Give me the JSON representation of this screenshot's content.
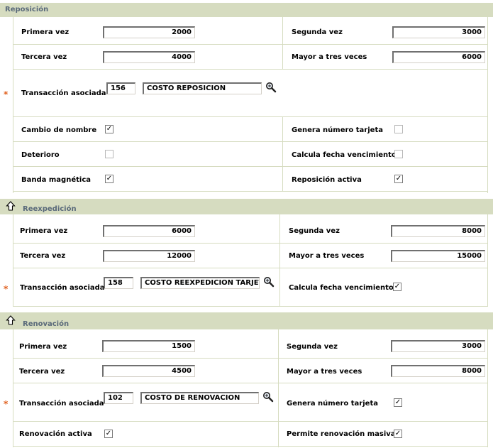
{
  "reposicion": {
    "title": "Reposición",
    "primera_label": "Primera vez",
    "primera_value": "2000",
    "segunda_label": "Segunda vez",
    "segunda_value": "3000",
    "tercera_label": "Tercera vez",
    "tercera_value": "4000",
    "mayor_label": "Mayor a tres veces",
    "mayor_value": "6000",
    "required_mark": "*",
    "transaccion_label": "Transacción asociada",
    "transaccion_code": "156",
    "transaccion_desc": "COSTO REPOSICION",
    "cambio_label": "Cambio de nombre",
    "cambio_checked": true,
    "genera_label": "Genera número tarjeta",
    "genera_checked": false,
    "deterioro_label": "Deterioro",
    "deterioro_checked": false,
    "calcula_label": "Calcula fecha vencimiento",
    "calcula_checked": false,
    "banda_label": "Banda magnética",
    "banda_checked": true,
    "activa_label": "Reposición activa",
    "activa_checked": true
  },
  "reexpedicion": {
    "title": "Reexpedición",
    "primera_label": "Primera vez",
    "primera_value": "6000",
    "segunda_label": "Segunda vez",
    "segunda_value": "8000",
    "tercera_label": "Tercera vez",
    "tercera_value": "12000",
    "mayor_label": "Mayor a tres veces",
    "mayor_value": "15000",
    "required_mark": "*",
    "transaccion_label": "Transacción asociada",
    "transaccion_code": "158",
    "transaccion_desc": "COSTO REEXPEDICION TARJETA",
    "calcula_label": "Calcula fecha vencimiento",
    "calcula_checked": true
  },
  "renovacion": {
    "title": "Renovación",
    "primera_label": "Primera vez",
    "primera_value": "1500",
    "segunda_label": "Segunda vez",
    "segunda_value": "3000",
    "tercera_label": "Tercera vez",
    "tercera_value": "4500",
    "mayor_label": "Mayor a tres veces",
    "mayor_value": "8000",
    "required_mark": "*",
    "transaccion_label": "Transacción asociada",
    "transaccion_code": "102",
    "transaccion_desc": "COSTO DE RENOVACION",
    "genera_label": "Genera número tarjeta",
    "genera_checked": true,
    "activa_label": "Renovación activa",
    "activa_checked": true,
    "masiva_label": "Permite renovación masiva",
    "masiva_checked": true
  },
  "icons": {
    "up": "up-arrow-icon",
    "search": "magnifier-icon"
  },
  "colors": {
    "header_bg": "#d6dcc0",
    "title": "#5a6a7a",
    "required": "#e0601e"
  }
}
